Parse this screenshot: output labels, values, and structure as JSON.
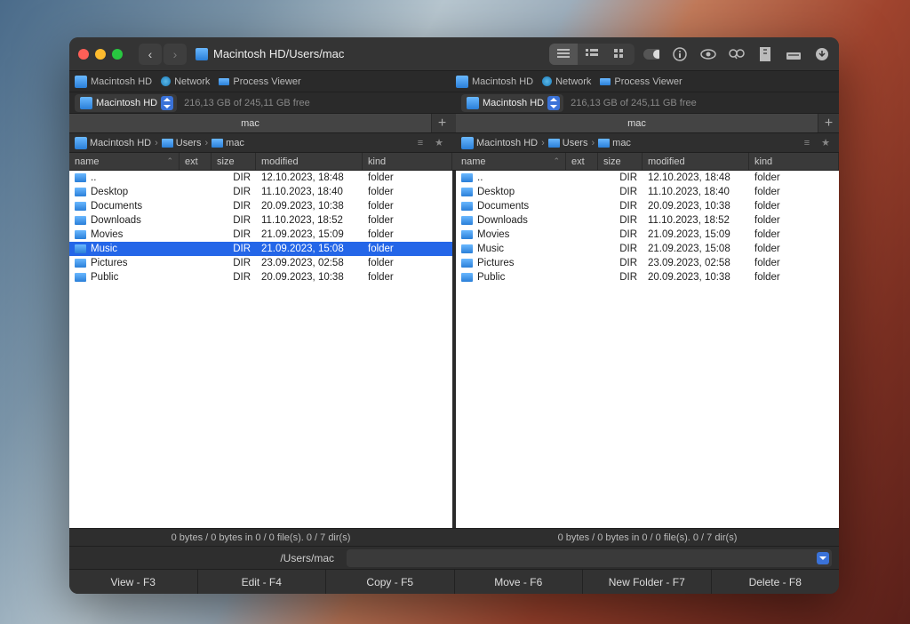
{
  "title": "Macintosh HD/Users/mac",
  "view_modes": [
    "list",
    "columns",
    "grid"
  ],
  "toolbar_icons": [
    "toggle",
    "info",
    "eye",
    "binoculars",
    "archive",
    "eject",
    "download"
  ],
  "secondary": {
    "items": [
      {
        "icon": "hd",
        "label": "Macintosh HD"
      },
      {
        "icon": "globe",
        "label": "Network"
      },
      {
        "icon": "proc",
        "label": "Process Viewer"
      }
    ]
  },
  "drive": {
    "name": "Macintosh HD",
    "freespace": "216,13 GB of 245,11 GB free"
  },
  "tab_label": "mac",
  "breadcrumb": [
    {
      "icon": "hd",
      "label": "Macintosh HD"
    },
    {
      "icon": "folder",
      "label": "Users"
    },
    {
      "icon": "folder",
      "label": "mac"
    }
  ],
  "columns": [
    {
      "key": "name",
      "label": "name",
      "sorted": true
    },
    {
      "key": "ext",
      "label": "ext"
    },
    {
      "key": "size",
      "label": "size"
    },
    {
      "key": "modified",
      "label": "modified"
    },
    {
      "key": "kind",
      "label": "kind"
    }
  ],
  "rows": [
    {
      "name": "..",
      "ext": "",
      "size": "DIR",
      "modified": "12.10.2023, 18:48",
      "kind": "folder"
    },
    {
      "name": "Desktop",
      "ext": "",
      "size": "DIR",
      "modified": "11.10.2023, 18:40",
      "kind": "folder"
    },
    {
      "name": "Documents",
      "ext": "",
      "size": "DIR",
      "modified": "20.09.2023, 10:38",
      "kind": "folder"
    },
    {
      "name": "Downloads",
      "ext": "",
      "size": "DIR",
      "modified": "11.10.2023, 18:52",
      "kind": "folder"
    },
    {
      "name": "Movies",
      "ext": "",
      "size": "DIR",
      "modified": "21.09.2023, 15:09",
      "kind": "folder"
    },
    {
      "name": "Music",
      "ext": "",
      "size": "DIR",
      "modified": "21.09.2023, 15:08",
      "kind": "folder"
    },
    {
      "name": "Pictures",
      "ext": "",
      "size": "DIR",
      "modified": "23.09.2023, 02:58",
      "kind": "folder"
    },
    {
      "name": "Public",
      "ext": "",
      "size": "DIR",
      "modified": "20.09.2023, 10:38",
      "kind": "folder"
    }
  ],
  "left_selected_index": 5,
  "status": "0 bytes / 0 bytes in 0 / 0 file(s). 0 / 7 dir(s)",
  "path_label": "/Users/mac",
  "fn_buttons": [
    "View - F3",
    "Edit - F4",
    "Copy - F5",
    "Move - F6",
    "New Folder - F7",
    "Delete - F8"
  ]
}
